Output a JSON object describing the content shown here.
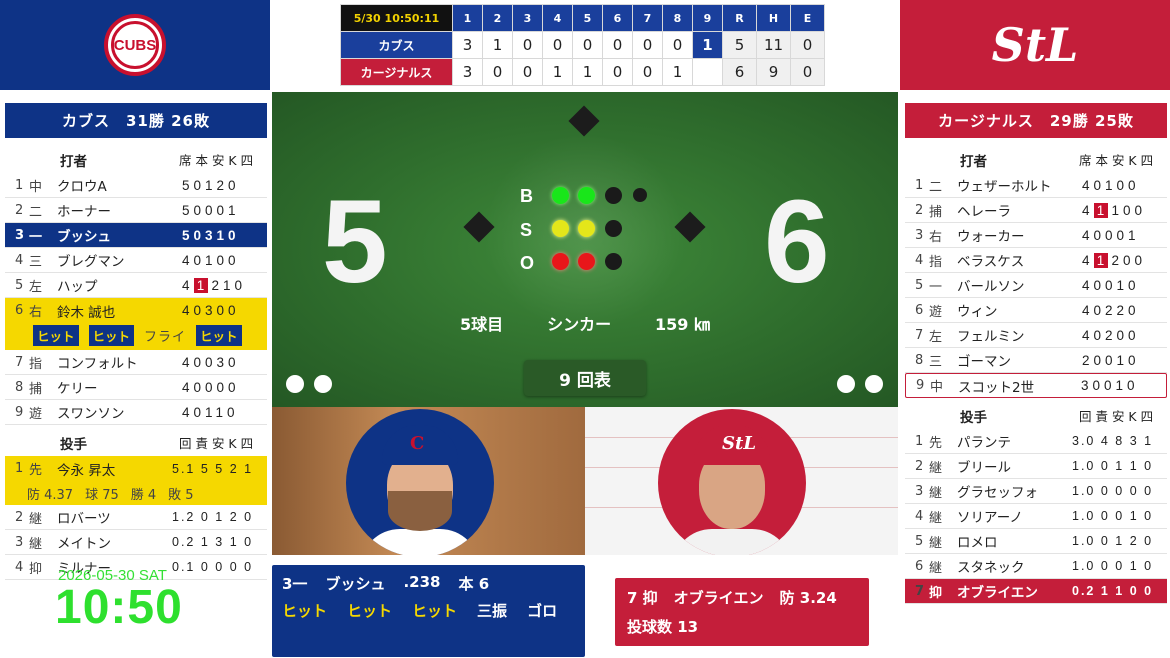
{
  "teams": {
    "cubs": {
      "logo_text": "CUBS",
      "color": "#0e3386"
    },
    "cards": {
      "logo_text": "StL",
      "color": "#c41e3a"
    }
  },
  "linescore": {
    "timestamp": "5/30 10:50:11",
    "innings": [
      "1",
      "2",
      "3",
      "4",
      "5",
      "6",
      "7",
      "8",
      "9"
    ],
    "rhe_headers": [
      "R",
      "H",
      "E"
    ],
    "rows": [
      {
        "team": "カブス",
        "scores": [
          "3",
          "1",
          "0",
          "0",
          "0",
          "0",
          "0",
          "0",
          "1"
        ],
        "rhe": [
          "5",
          "11",
          "0"
        ]
      },
      {
        "team": "カージナルス",
        "scores": [
          "3",
          "0",
          "0",
          "1",
          "1",
          "0",
          "0",
          "1",
          ""
        ],
        "rhe": [
          "6",
          "9",
          "0"
        ]
      }
    ]
  },
  "cubs_panel": {
    "title": "カブス　31勝 26敗",
    "batter_header": "打者",
    "batter_cols": "席 本 安 K 四",
    "batters": [
      {
        "no": "1",
        "pos": "中",
        "name": "クロウA",
        "stats": "50120"
      },
      {
        "no": "2",
        "pos": "二",
        "name": "ホーナー",
        "stats": "50001"
      },
      {
        "no": "3",
        "pos": "一",
        "name": "ブッシュ",
        "stats": "50310"
      },
      {
        "no": "4",
        "pos": "三",
        "name": "ブレグマン",
        "stats": "40100"
      },
      {
        "no": "5",
        "pos": "左",
        "name": "ハップ",
        "stats_pre": "4",
        "stats_hit": "1",
        "stats_post": "210"
      },
      {
        "no": "6",
        "pos": "右",
        "name": "鈴木 誠也",
        "stats": "40300"
      },
      {
        "no": "7",
        "pos": "指",
        "name": "コンフォルト",
        "stats": "40030"
      },
      {
        "no": "8",
        "pos": "捕",
        "name": "ケリー",
        "stats": "40000"
      },
      {
        "no": "9",
        "pos": "遊",
        "name": "スワンソン",
        "stats": "40110"
      }
    ],
    "suzuki_chips": [
      "ヒット",
      "ヒット",
      "フライ",
      "ヒット"
    ],
    "pitcher_header": "投手",
    "pitcher_cols": "回 責 安 K 四",
    "pitchers": [
      {
        "no": "1",
        "pos": "先",
        "name": "今永 昇太",
        "stats": "5.1 5 5 2 1"
      },
      {
        "no": "2",
        "pos": "継",
        "name": "ロバーツ",
        "stats": "1.2 0 1 2 0"
      },
      {
        "no": "3",
        "pos": "継",
        "name": "メイトン",
        "stats": "0.2 1 3 1 0"
      },
      {
        "no": "4",
        "pos": "抑",
        "name": "ミルナー",
        "stats": "0.1 0 0 0 0"
      }
    ],
    "imanaga_sub": [
      "防 4.37",
      "球 75",
      "勝 4",
      "敗 5"
    ]
  },
  "cards_panel": {
    "title": "カージナルス　29勝 25敗",
    "batter_header": "打者",
    "batter_cols": "席 本 安 K 四",
    "batters": [
      {
        "no": "1",
        "pos": "二",
        "name": "ウェザーホルト",
        "stats": "40100"
      },
      {
        "no": "2",
        "pos": "捕",
        "name": "ヘレーラ",
        "stats_pre": "4",
        "stats_hit": "1",
        "stats_post": "100"
      },
      {
        "no": "3",
        "pos": "右",
        "name": "ウォーカー",
        "stats": "40001"
      },
      {
        "no": "4",
        "pos": "指",
        "name": "ベラスケス",
        "stats_pre": "4",
        "stats_hit": "1",
        "stats_post": "200"
      },
      {
        "no": "5",
        "pos": "一",
        "name": "バールソン",
        "stats": "40010"
      },
      {
        "no": "6",
        "pos": "遊",
        "name": "ウィン",
        "stats": "40220"
      },
      {
        "no": "7",
        "pos": "左",
        "name": "フェルミン",
        "stats": "40200"
      },
      {
        "no": "8",
        "pos": "三",
        "name": "ゴーマン",
        "stats": "20010"
      },
      {
        "no": "9",
        "pos": "中",
        "name": "スコット2世",
        "stats": "30010"
      }
    ],
    "pitcher_header": "投手",
    "pitcher_cols": "回 責 安 K 四",
    "pitchers": [
      {
        "no": "1",
        "pos": "先",
        "name": "パランテ",
        "stats": "3.0 4 8 3 1"
      },
      {
        "no": "2",
        "pos": "継",
        "name": "ブリール",
        "stats": "1.0 0 1 1 0"
      },
      {
        "no": "3",
        "pos": "継",
        "name": "グラセッフォ",
        "stats": "1.0 0 0 0 0"
      },
      {
        "no": "4",
        "pos": "継",
        "name": "ソリアーノ",
        "stats": "1.0 0 0 1 0"
      },
      {
        "no": "5",
        "pos": "継",
        "name": "ロメロ",
        "stats": "1.0 0 1 2 0"
      },
      {
        "no": "6",
        "pos": "継",
        "name": "スタネック",
        "stats": "1.0 0 0 1 0"
      },
      {
        "no": "7",
        "pos": "抑",
        "name": "オブライエン",
        "stats": "0.2 1 1 0 0"
      }
    ]
  },
  "field": {
    "away_score": "5",
    "home_score": "6",
    "count_labels": [
      "B",
      "S",
      "O"
    ],
    "balls": 2,
    "strikes": 2,
    "outs": 2,
    "pitch_no": "5球目",
    "pitch_type": "シンカー",
    "pitch_speed": "159 ㎞",
    "inning": "9 回表"
  },
  "batter_card": {
    "line1": [
      "3一",
      "ブッシュ",
      ".238",
      "本 6"
    ],
    "results": [
      "ヒット",
      "ヒット",
      "ヒット",
      "三振",
      "ゴロ"
    ]
  },
  "pitcher_card": {
    "line1": [
      "7 抑",
      "オブライエン",
      "防 3.24"
    ],
    "line2": "投球数 13"
  },
  "clock": {
    "date": "2026-05-30 SAT",
    "time": "10:50"
  }
}
